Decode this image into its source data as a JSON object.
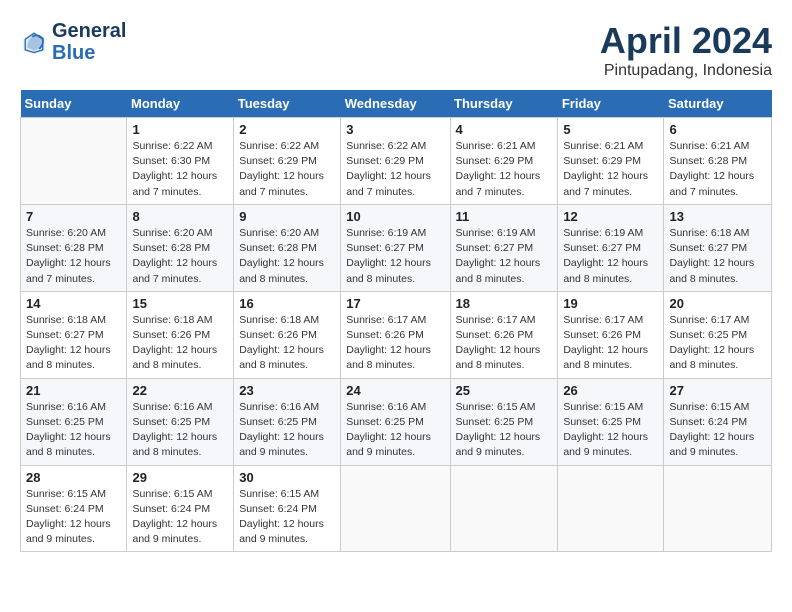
{
  "header": {
    "logo_line1": "General",
    "logo_line2": "Blue",
    "month": "April 2024",
    "location": "Pintupadang, Indonesia"
  },
  "days_of_week": [
    "Sunday",
    "Monday",
    "Tuesday",
    "Wednesday",
    "Thursday",
    "Friday",
    "Saturday"
  ],
  "weeks": [
    [
      {
        "num": "",
        "empty": true
      },
      {
        "num": "1",
        "sunrise": "6:22 AM",
        "sunset": "6:30 PM",
        "daylight": "12 hours and 7 minutes."
      },
      {
        "num": "2",
        "sunrise": "6:22 AM",
        "sunset": "6:29 PM",
        "daylight": "12 hours and 7 minutes."
      },
      {
        "num": "3",
        "sunrise": "6:22 AM",
        "sunset": "6:29 PM",
        "daylight": "12 hours and 7 minutes."
      },
      {
        "num": "4",
        "sunrise": "6:21 AM",
        "sunset": "6:29 PM",
        "daylight": "12 hours and 7 minutes."
      },
      {
        "num": "5",
        "sunrise": "6:21 AM",
        "sunset": "6:29 PM",
        "daylight": "12 hours and 7 minutes."
      },
      {
        "num": "6",
        "sunrise": "6:21 AM",
        "sunset": "6:28 PM",
        "daylight": "12 hours and 7 minutes."
      }
    ],
    [
      {
        "num": "7",
        "sunrise": "6:20 AM",
        "sunset": "6:28 PM",
        "daylight": "12 hours and 7 minutes."
      },
      {
        "num": "8",
        "sunrise": "6:20 AM",
        "sunset": "6:28 PM",
        "daylight": "12 hours and 7 minutes."
      },
      {
        "num": "9",
        "sunrise": "6:20 AM",
        "sunset": "6:28 PM",
        "daylight": "12 hours and 8 minutes."
      },
      {
        "num": "10",
        "sunrise": "6:19 AM",
        "sunset": "6:27 PM",
        "daylight": "12 hours and 8 minutes."
      },
      {
        "num": "11",
        "sunrise": "6:19 AM",
        "sunset": "6:27 PM",
        "daylight": "12 hours and 8 minutes."
      },
      {
        "num": "12",
        "sunrise": "6:19 AM",
        "sunset": "6:27 PM",
        "daylight": "12 hours and 8 minutes."
      },
      {
        "num": "13",
        "sunrise": "6:18 AM",
        "sunset": "6:27 PM",
        "daylight": "12 hours and 8 minutes."
      }
    ],
    [
      {
        "num": "14",
        "sunrise": "6:18 AM",
        "sunset": "6:27 PM",
        "daylight": "12 hours and 8 minutes."
      },
      {
        "num": "15",
        "sunrise": "6:18 AM",
        "sunset": "6:26 PM",
        "daylight": "12 hours and 8 minutes."
      },
      {
        "num": "16",
        "sunrise": "6:18 AM",
        "sunset": "6:26 PM",
        "daylight": "12 hours and 8 minutes."
      },
      {
        "num": "17",
        "sunrise": "6:17 AM",
        "sunset": "6:26 PM",
        "daylight": "12 hours and 8 minutes."
      },
      {
        "num": "18",
        "sunrise": "6:17 AM",
        "sunset": "6:26 PM",
        "daylight": "12 hours and 8 minutes."
      },
      {
        "num": "19",
        "sunrise": "6:17 AM",
        "sunset": "6:26 PM",
        "daylight": "12 hours and 8 minutes."
      },
      {
        "num": "20",
        "sunrise": "6:17 AM",
        "sunset": "6:25 PM",
        "daylight": "12 hours and 8 minutes."
      }
    ],
    [
      {
        "num": "21",
        "sunrise": "6:16 AM",
        "sunset": "6:25 PM",
        "daylight": "12 hours and 8 minutes."
      },
      {
        "num": "22",
        "sunrise": "6:16 AM",
        "sunset": "6:25 PM",
        "daylight": "12 hours and 8 minutes."
      },
      {
        "num": "23",
        "sunrise": "6:16 AM",
        "sunset": "6:25 PM",
        "daylight": "12 hours and 9 minutes."
      },
      {
        "num": "24",
        "sunrise": "6:16 AM",
        "sunset": "6:25 PM",
        "daylight": "12 hours and 9 minutes."
      },
      {
        "num": "25",
        "sunrise": "6:15 AM",
        "sunset": "6:25 PM",
        "daylight": "12 hours and 9 minutes."
      },
      {
        "num": "26",
        "sunrise": "6:15 AM",
        "sunset": "6:25 PM",
        "daylight": "12 hours and 9 minutes."
      },
      {
        "num": "27",
        "sunrise": "6:15 AM",
        "sunset": "6:24 PM",
        "daylight": "12 hours and 9 minutes."
      }
    ],
    [
      {
        "num": "28",
        "sunrise": "6:15 AM",
        "sunset": "6:24 PM",
        "daylight": "12 hours and 9 minutes."
      },
      {
        "num": "29",
        "sunrise": "6:15 AM",
        "sunset": "6:24 PM",
        "daylight": "12 hours and 9 minutes."
      },
      {
        "num": "30",
        "sunrise": "6:15 AM",
        "sunset": "6:24 PM",
        "daylight": "12 hours and 9 minutes."
      },
      {
        "num": "",
        "empty": true
      },
      {
        "num": "",
        "empty": true
      },
      {
        "num": "",
        "empty": true
      },
      {
        "num": "",
        "empty": true
      }
    ]
  ],
  "labels": {
    "sunrise_prefix": "Sunrise: ",
    "sunset_prefix": "Sunset: ",
    "daylight_prefix": "Daylight: "
  }
}
